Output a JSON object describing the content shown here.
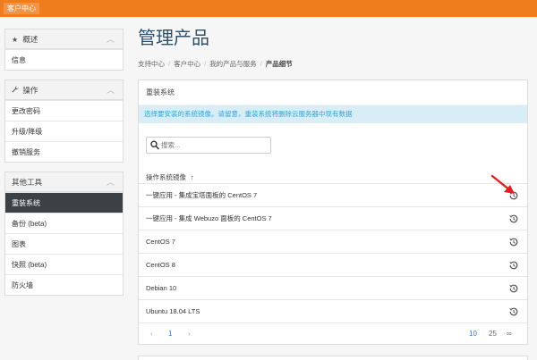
{
  "topbar": {
    "label": "客户中心"
  },
  "sidebar": {
    "panels": [
      {
        "title": "概述",
        "icon": "star-icon",
        "items": [
          {
            "label": "信息"
          }
        ]
      },
      {
        "title": "操作",
        "icon": "wrench-icon",
        "items": [
          {
            "label": "更改密码"
          },
          {
            "label": "升级/降级"
          },
          {
            "label": "撤销服务"
          }
        ]
      },
      {
        "title": "其他工具",
        "icon": "",
        "items": [
          {
            "label": "重装系统",
            "active": true
          },
          {
            "label": "备份 (beta)"
          },
          {
            "label": "图表"
          },
          {
            "label": "快照 (beta)"
          },
          {
            "label": "防火墙"
          }
        ]
      }
    ]
  },
  "main": {
    "title": "管理产品",
    "breadcrumb": [
      "支持中心",
      "客户中心",
      "我的产品与服务",
      "产品细节"
    ],
    "card": {
      "title": "重装系统",
      "alert": "选择要安装的系统镜像。请留意，重装系统将删除云服务器中现有数据",
      "search": {
        "placeholder": "搜索..."
      },
      "column": {
        "label": "操作系统镜像",
        "sort_arrow": "↑"
      },
      "rows": [
        {
          "label": "一键应用 - 集成宝塔面板的 CentOS 7"
        },
        {
          "label": "一键应用 - 集成 Webuzo 面板的 CentOS 7"
        },
        {
          "label": "CentOS 7"
        },
        {
          "label": "CentOS 8"
        },
        {
          "label": "Debian 10"
        },
        {
          "label": "Ubuntu 18.04 LTS"
        }
      ],
      "pagination": {
        "prev": "‹",
        "current": "1",
        "next": "›",
        "sizes": [
          "10",
          "25",
          "∞"
        ]
      }
    }
  },
  "colors": {
    "topbar": "#f07d1d",
    "accent": "#2b7bc7",
    "alert_bg": "#d9edf7",
    "alert_text": "#31a5d9",
    "annotation": "#e02020"
  },
  "row_icon": "restore-icon"
}
